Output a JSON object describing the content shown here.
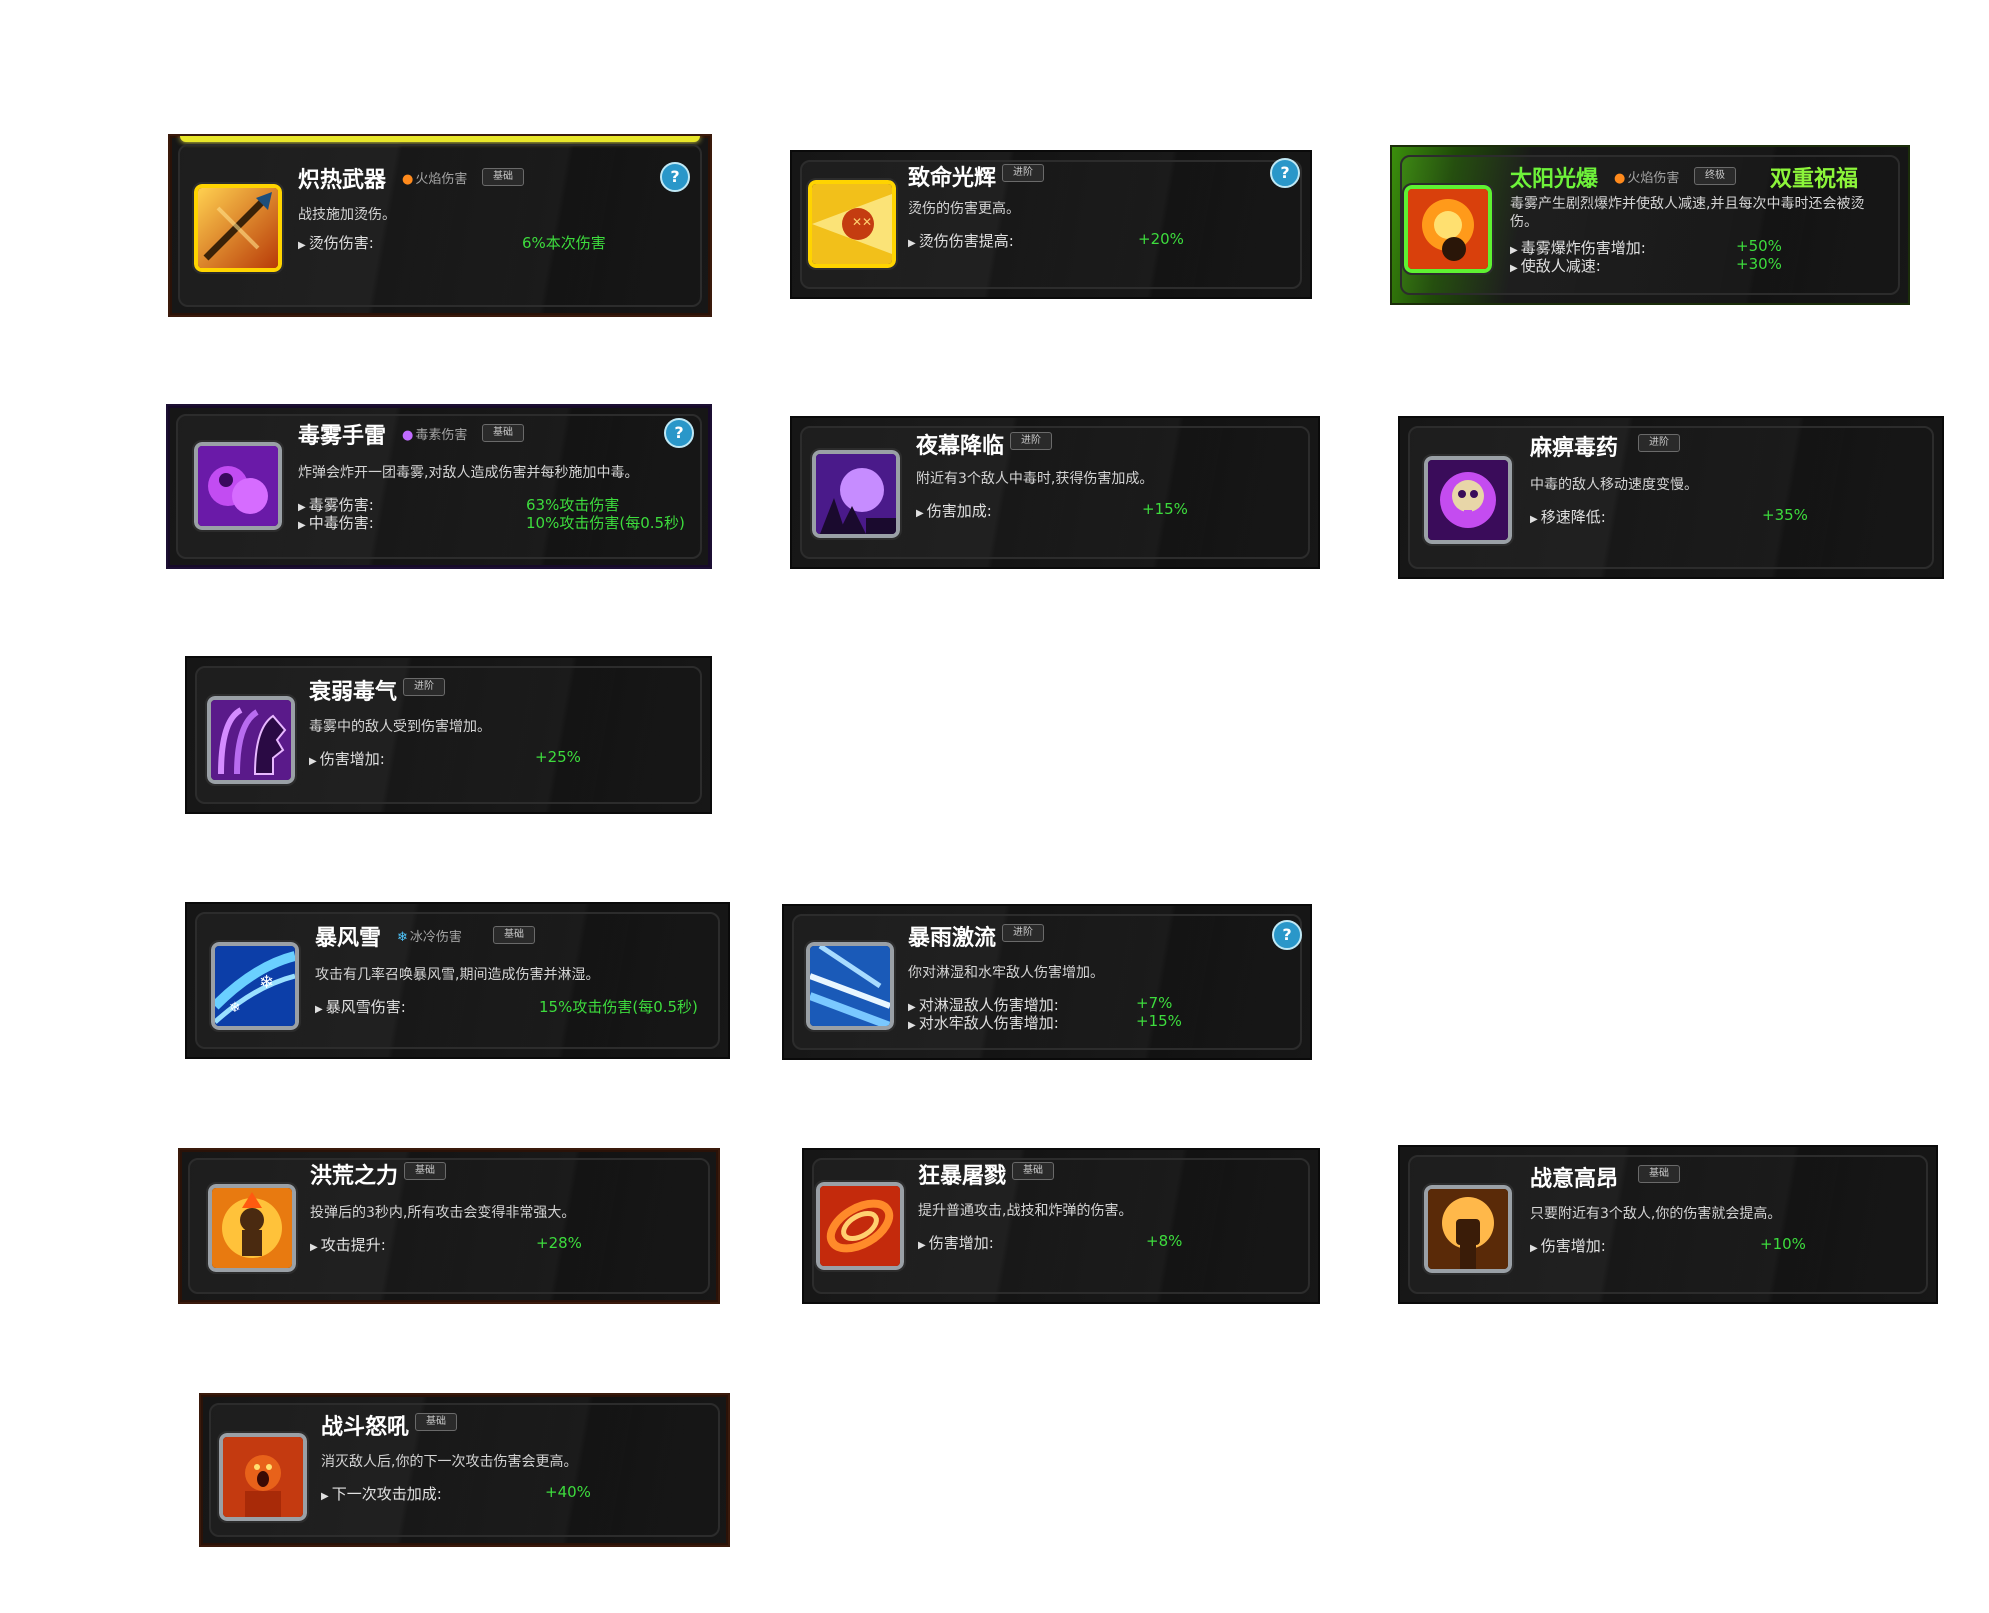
{
  "cards": [
    {
      "title": "炽热武器",
      "dmg": "火焰伤害",
      "dmg_color": "#ff8a1c",
      "badge": "基础",
      "desc": "战技施加烫伤。",
      "stats": [
        {
          "label": "烫伤伤害:",
          "value": "6%本次伤害"
        }
      ],
      "help": "?",
      "icon": "flaming-spear-icon"
    },
    {
      "title": "致命光辉",
      "badge": "进阶",
      "desc": "烫伤的伤害更高。",
      "stats": [
        {
          "label": "烫伤伤害提高:",
          "value": "+20%"
        }
      ],
      "help": "?",
      "icon": "radiant-burst-icon"
    },
    {
      "title": "太阳光爆",
      "dmg": "火焰伤害",
      "dmg_color": "#ff8a1c",
      "badge": "终极",
      "blessing": "双重祝福",
      "desc": "毒雾产生剧烈爆炸并使敌人减速,并且每次中毒时还会被烫伤。",
      "stats": [
        {
          "label": "毒雾爆炸伤害增加:",
          "value": "+50%"
        },
        {
          "label": "使敌人减速:",
          "value": "+30%"
        }
      ],
      "icon": "sun-bomb-icon"
    },
    {
      "title": "毒雾手雷",
      "dmg": "毒素伤害",
      "dmg_color": "#c06bff",
      "badge": "基础",
      "desc": "炸弹会炸开一团毒雾,对敌人造成伤害并每秒施加中毒。",
      "stats": [
        {
          "label": "毒雾伤害:",
          "value": "63%攻击伤害"
        },
        {
          "label": "中毒伤害:",
          "value": "10%攻击伤害(每0.5秒)"
        }
      ],
      "help": "?",
      "icon": "poison-cloud-icon"
    },
    {
      "title": "夜幕降临",
      "badge": "进阶",
      "desc": "附近有3个敌人中毒时,获得伤害加成。",
      "stats": [
        {
          "label": "伤害加成:",
          "value": "+15%"
        }
      ],
      "icon": "night-moon-icon"
    },
    {
      "title": "麻痹毒药",
      "badge": "进阶",
      "desc": "中毒的敌人移动速度变慢。",
      "stats": [
        {
          "label": "移速降低:",
          "value": "+35%"
        }
      ],
      "icon": "skull-poison-icon"
    },
    {
      "title": "衰弱毒气",
      "badge": "进阶",
      "desc": "毒雾中的敌人受到伤害增加。",
      "stats": [
        {
          "label": "伤害增加:",
          "value": "+25%"
        }
      ],
      "icon": "fading-heads-icon"
    },
    {
      "title": "暴风雪",
      "dmg": "冰冷伤害",
      "dmg_color": "#4fc8ff",
      "badge": "基础",
      "desc": "攻击有几率召唤暴风雪,期间造成伤害并淋湿。",
      "stats": [
        {
          "label": "暴风雪伤害:",
          "value": "15%攻击伤害(每0.5秒)"
        }
      ],
      "icon": "blizzard-icon"
    },
    {
      "title": "暴雨激流",
      "badge": "进阶",
      "desc": "你对淋湿和水牢敌人伤害增加。",
      "stats": [
        {
          "label": "对淋湿敌人伤害增加:",
          "value": "+7%"
        },
        {
          "label": "对水牢敌人伤害增加:",
          "value": "+15%"
        }
      ],
      "help": "?",
      "icon": "torrent-icon"
    },
    {
      "title": "洪荒之力",
      "badge": "基础",
      "desc": "投弹后的3秒内,所有攻击会变得非常强大。",
      "stats": [
        {
          "label": "攻击提升:",
          "value": "+28%"
        }
      ],
      "icon": "primal-power-icon"
    },
    {
      "title": "狂暴屠戮",
      "badge": "基础",
      "desc": "提升普通攻击,战技和炸弹的伤害。",
      "stats": [
        {
          "label": "伤害增加:",
          "value": "+8%"
        }
      ],
      "icon": "rampage-swirl-icon"
    },
    {
      "title": "战意高昂",
      "badge": "基础",
      "desc": "只要附近有3个敌人,你的伤害就会提高。",
      "stats": [
        {
          "label": "伤害增加:",
          "value": "+10%"
        }
      ],
      "icon": "raised-fist-icon"
    },
    {
      "title": "战斗怒吼",
      "badge": "基础",
      "desc": "消灭敌人后,你的下一次攻击伤害会更高。",
      "stats": [
        {
          "label": "下一次攻击加成:",
          "value": "+40%"
        }
      ],
      "icon": "battle-roar-icon"
    }
  ]
}
